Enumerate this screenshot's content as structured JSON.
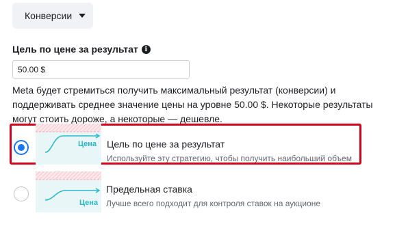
{
  "goal_dropdown": {
    "label": "Конверсии",
    "icon": "caret-down-icon"
  },
  "bid": {
    "label": "Цель по цене за результат",
    "info_icon": "i",
    "input_value": "50.00 $"
  },
  "description": "Meta будет стремиться получить максимальный результат (конверсии) и поддерживать среднее значение цены на уровне 50.00 $. Некоторые результаты могут стоить дороже, а некоторые — дешевле.",
  "options": [
    {
      "title": "Цель по цене за результат",
      "subtitle": "Используйте эту стратегию, чтобы получить наибольший объем",
      "thumb_label": "Цена",
      "selected": true
    },
    {
      "title": "Предельная ставка",
      "subtitle": "Лучше всего подходит для контроля ставок на аукционе",
      "thumb_label": "Цена",
      "selected": false
    }
  ],
  "colors": {
    "accent": "#1877f2",
    "highlight_border": "#d0021b",
    "thumb_line": "#2ab7c9",
    "thumb_bg": "#e9f6f7"
  }
}
